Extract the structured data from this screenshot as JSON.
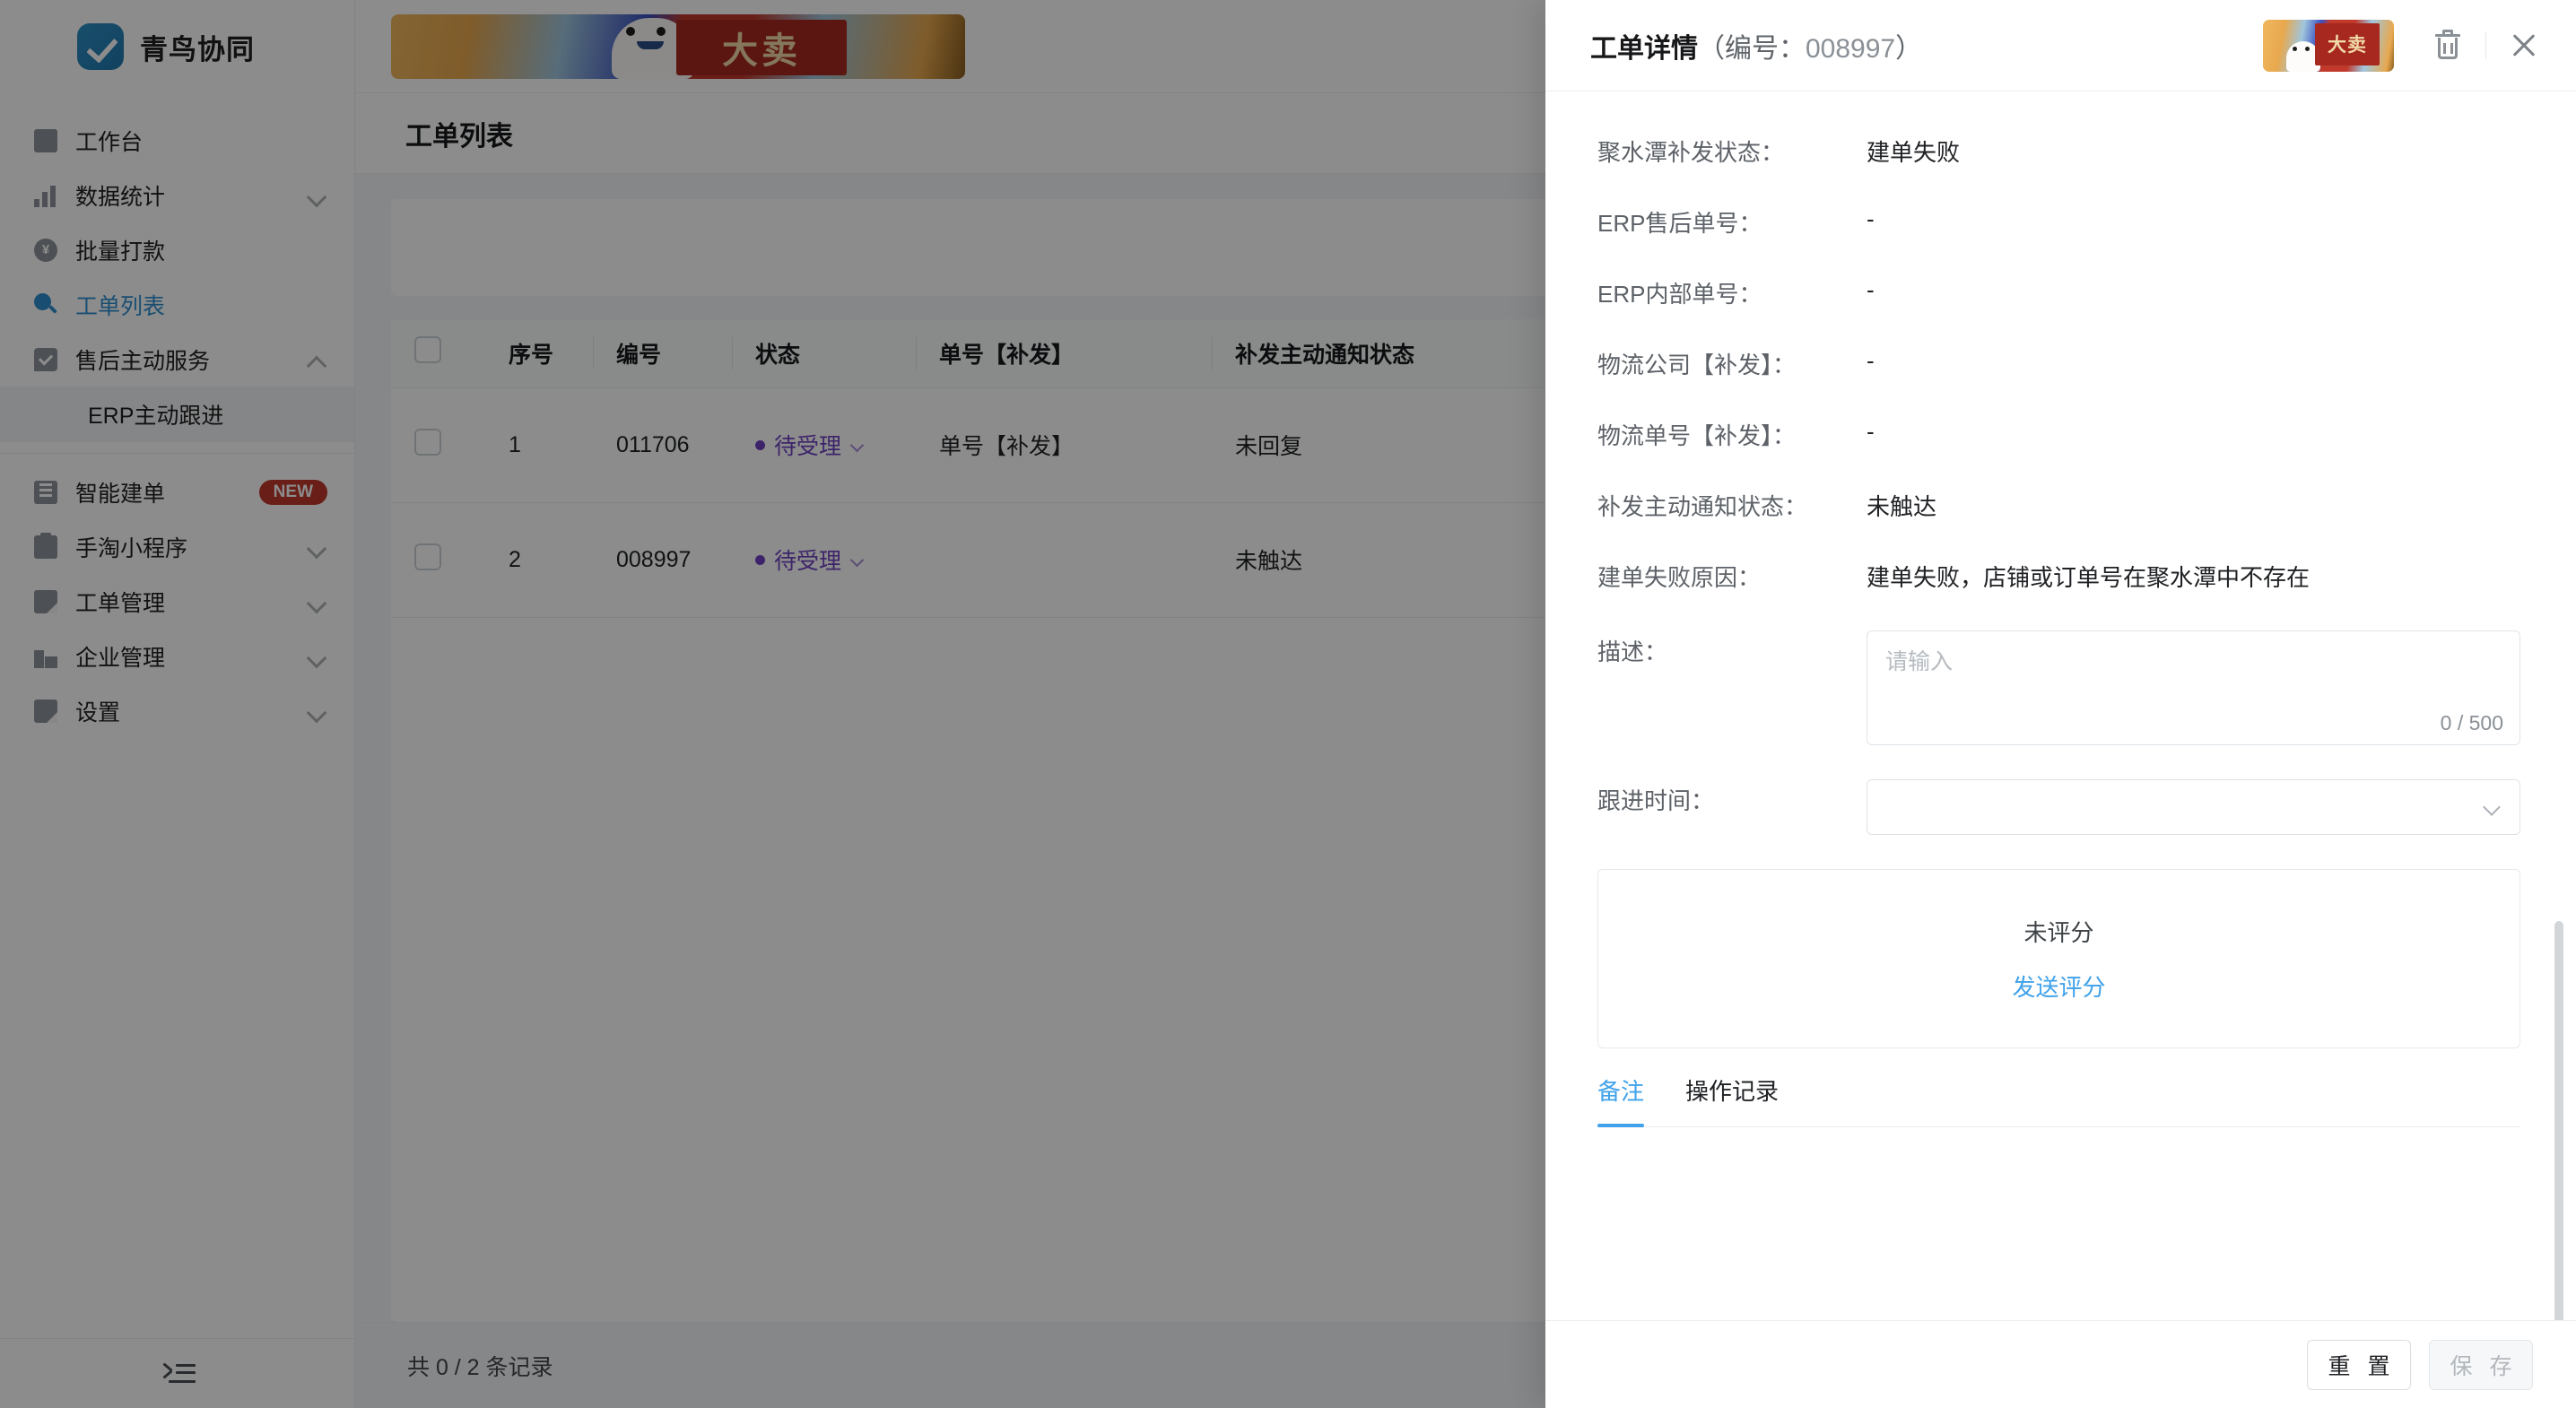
{
  "brand": {
    "name": "青鸟协同",
    "logo_icon": "check-logo-icon"
  },
  "sidebar": {
    "items": [
      {
        "label": "工作台",
        "icon": "monitor-icon",
        "chevron": "",
        "active": false
      },
      {
        "label": "数据统计",
        "icon": "bar-chart-icon",
        "chevron": "down",
        "active": false
      },
      {
        "label": "批量打款",
        "icon": "yuan-circle-icon",
        "chevron": "",
        "active": false
      },
      {
        "label": "工单列表",
        "icon": "search-icon",
        "chevron": "",
        "active": true
      },
      {
        "label": "售后主动服务",
        "icon": "chat-check-icon",
        "chevron": "up",
        "active": false
      },
      {
        "label": "智能建单",
        "icon": "list-icon",
        "chevron": "",
        "badge": "NEW",
        "active": false
      },
      {
        "label": "手淘小程序",
        "icon": "clipboard-icon",
        "chevron": "down",
        "active": false
      },
      {
        "label": "工单管理",
        "icon": "document-icon",
        "chevron": "down",
        "active": false
      },
      {
        "label": "企业管理",
        "icon": "building-icon",
        "chevron": "down",
        "active": false
      },
      {
        "label": "设置",
        "icon": "settings-doc-icon",
        "chevron": "down",
        "active": false
      }
    ],
    "sub_item": {
      "label": "ERP主动跟进"
    },
    "collapse_icon": "collapse-sidebar-icon"
  },
  "topbar": {
    "promo_text": "大卖",
    "promo_icon": "promo-banner-image"
  },
  "page": {
    "title": "工单列表"
  },
  "table": {
    "columns": [
      "",
      "序号",
      "编号",
      "状态",
      "单号【补发】",
      "补发主动通知状态"
    ],
    "rows": [
      {
        "index": "1",
        "code": "011706",
        "status": "待受理",
        "order_no": "单号【补发】",
        "notify_status": "未回复"
      },
      {
        "index": "2",
        "code": "008997",
        "status": "待受理",
        "order_no": "",
        "notify_status": "未触达"
      }
    ],
    "footer_count": "共 0 / 2 条记录"
  },
  "drawer": {
    "title_main": "工单详情",
    "title_paren_open": "（编号：",
    "title_number": "008997",
    "title_paren_close": "）",
    "promo_text": "大卖",
    "delete_icon": "trash-icon",
    "close_icon": "close-icon",
    "fields": [
      {
        "label": "聚水潭补发状态：",
        "value": "建单失败"
      },
      {
        "label": "ERP售后单号：",
        "value": "-"
      },
      {
        "label": "ERP内部单号：",
        "value": "-"
      },
      {
        "label": "物流公司【补发】：",
        "value": "-"
      },
      {
        "label": "物流单号【补发】：",
        "value": "-"
      },
      {
        "label": "补发主动通知状态：",
        "value": "未触达"
      },
      {
        "label": "建单失败原因：",
        "value": "建单失败，店铺或订单号在聚水潭中不存在"
      }
    ],
    "description": {
      "label": "描述：",
      "placeholder": "请输入",
      "value": "",
      "counter": "0 / 500"
    },
    "follow_time": {
      "label": "跟进时间：",
      "value": "",
      "chevron_icon": "chevron-down-icon"
    },
    "rating": {
      "status_text": "未评分",
      "send_label": "发送评分"
    },
    "tabs": [
      {
        "label": "备注",
        "active": true
      },
      {
        "label": "操作记录",
        "active": false
      }
    ],
    "footer": {
      "reset_label": "重 置",
      "save_label": "保 存",
      "save_disabled": true
    }
  },
  "colors": {
    "accent_blue": "#3fa2ea",
    "status_purple": "#6f42c1",
    "badge_red": "#c0392b",
    "brand_blue": "#2079b0"
  }
}
